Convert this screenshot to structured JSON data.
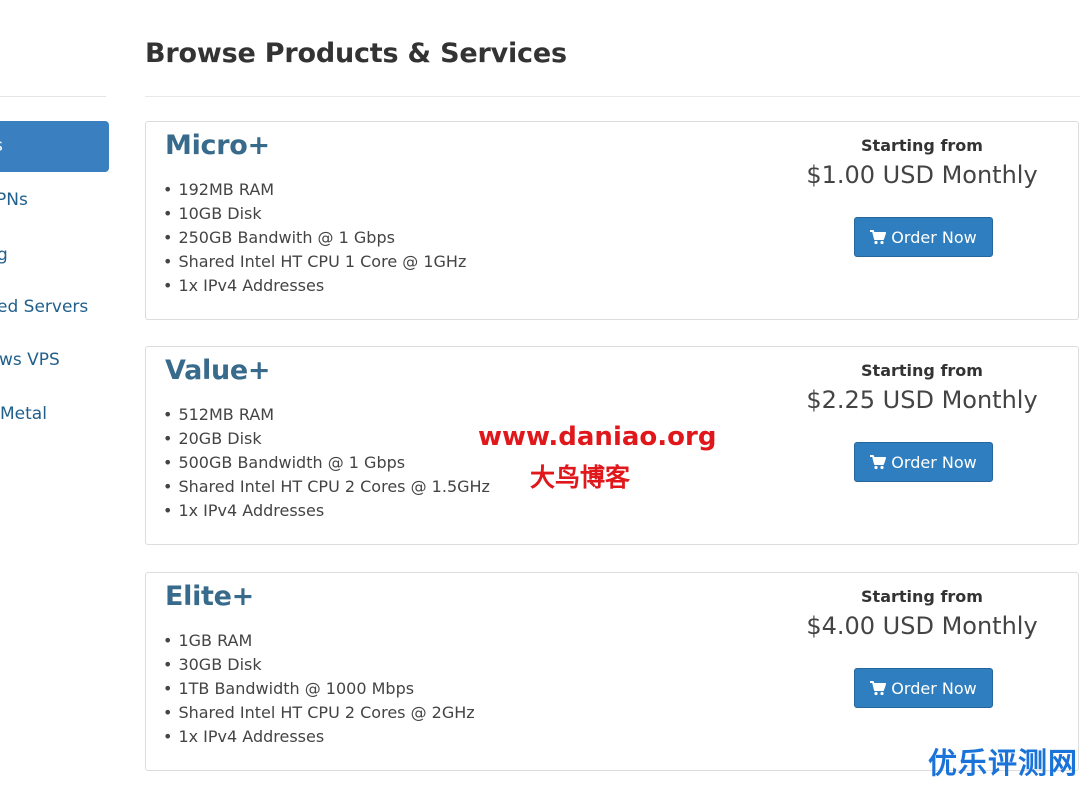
{
  "page": {
    "title": "Browse Products & Services"
  },
  "sidebar": {
    "items": [
      {
        "label": "s",
        "active": true
      },
      {
        "label": "PNs",
        "active": false
      },
      {
        "label": "g",
        "active": false
      },
      {
        "label": "ed Servers",
        "active": false
      },
      {
        "label": "ws VPS",
        "active": false
      },
      {
        "label": "Metal",
        "active": false
      }
    ]
  },
  "products": [
    {
      "name": "Micro+",
      "features": [
        "192MB RAM",
        "10GB Disk",
        "250GB Bandwith @ 1 Gbps",
        "Shared Intel HT CPU 1 Core @ 1GHz",
        "1x IPv4 Addresses"
      ],
      "starting_from": "Starting from",
      "price": "$1.00 USD Monthly",
      "order_label": "Order Now"
    },
    {
      "name": "Value+",
      "features": [
        "512MB RAM",
        "20GB Disk",
        "500GB Bandwidth @ 1 Gbps",
        "Shared Intel HT CPU 2 Cores @ 1.5GHz",
        "1x IPv4 Addresses"
      ],
      "starting_from": "Starting from",
      "price": "$2.25 USD Monthly",
      "order_label": "Order Now"
    },
    {
      "name": "Elite+",
      "features": [
        "1GB RAM",
        "30GB Disk",
        "1TB Bandwidth @ 1000 Mbps",
        "Shared Intel HT CPU 2 Cores @ 2GHz",
        "1x IPv4 Addresses"
      ],
      "starting_from": "Starting from",
      "price": "$4.00 USD Monthly",
      "order_label": "Order Now"
    }
  ],
  "watermarks": {
    "site": "www.daniao.org",
    "blog": "大鸟博客",
    "corner": "优乐评测网"
  },
  "icons": {
    "order": "cart-icon"
  },
  "colors": {
    "accent": "#2f7ebf",
    "product_title": "#386a8c",
    "sidebar_active": "#3a7fbf",
    "watermark_red": "#e0181b",
    "watermark_blue": "#1a73d9"
  }
}
